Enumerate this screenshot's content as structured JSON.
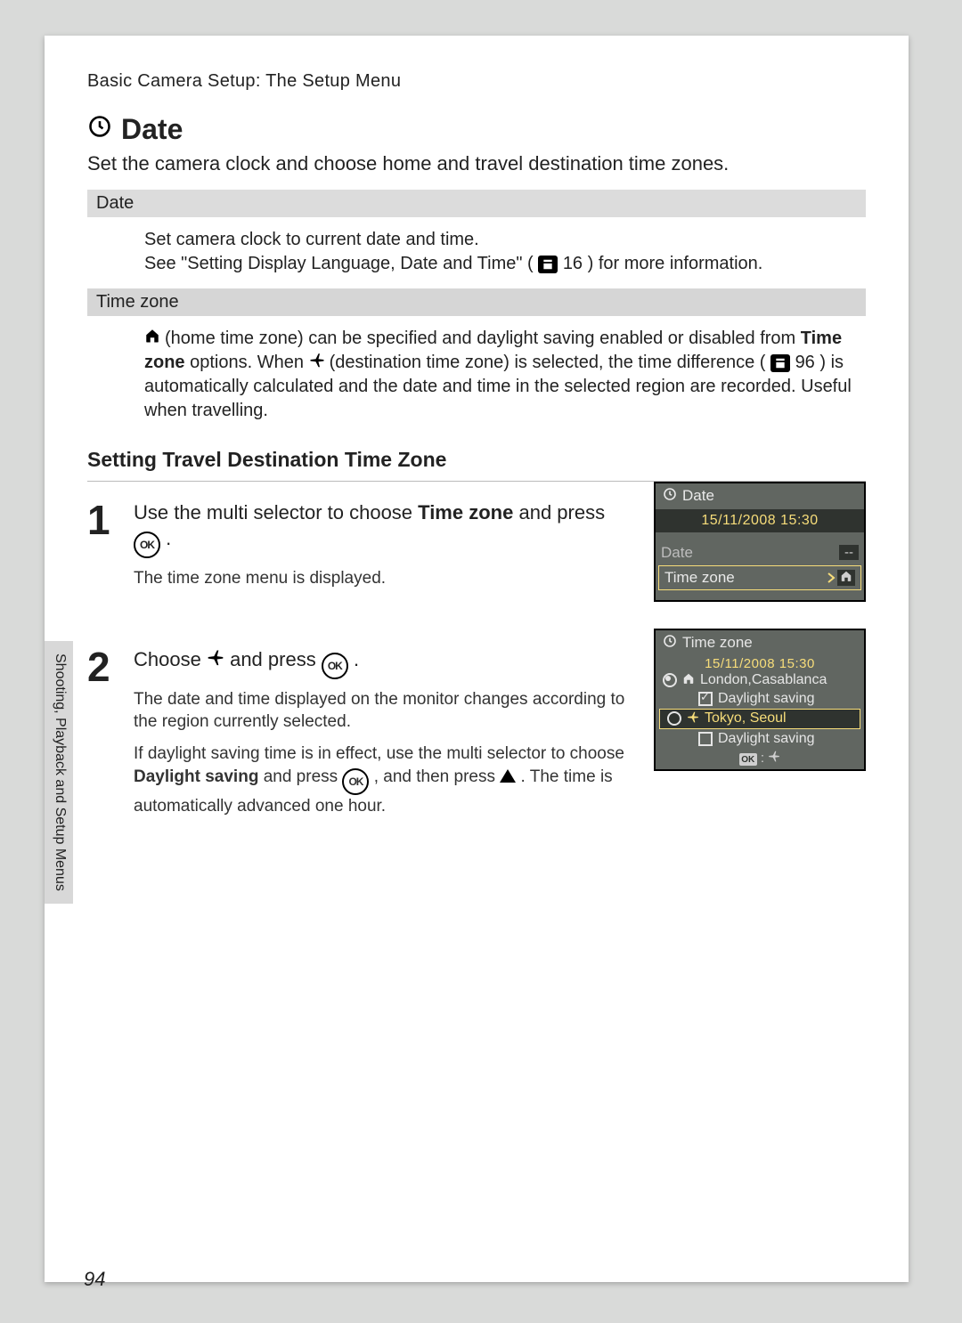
{
  "header": "Basic Camera Setup: The Setup Menu",
  "title": "Date",
  "intro": "Set the camera clock and choose home and travel destination time zones.",
  "sections": {
    "date": {
      "label": "Date",
      "body1": "Set camera clock to current date and time.",
      "body2a": "See \"Setting Display Language, Date and Time\" (",
      "body2_ref": "16",
      "body2b": ") for more information."
    },
    "tz": {
      "label": "Time zone",
      "b1a": " (home time zone) can be specified and daylight saving enabled or disabled from ",
      "bold": "Time zone",
      "b1b": " options. When ",
      "b1c": " (destination time zone) is selected, the time difference (",
      "ref": "96",
      "b1d": ") is automatically calculated and the date and time in the selected region are recorded. Useful when travelling."
    }
  },
  "subhead": "Setting Travel Destination Time Zone",
  "steps": {
    "s1": {
      "num": "1",
      "lead_a": "Use the multi selector to choose ",
      "lead_bold": "Time zone",
      "lead_b": " and press ",
      "lead_c": ".",
      "note": "The time zone menu is displayed."
    },
    "s2": {
      "num": "2",
      "lead_a": "Choose ",
      "lead_b": " and press ",
      "lead_c": ".",
      "note1": "The date and time displayed on the monitor changes according to the region currently selected.",
      "note2a": "If daylight saving time is in effect, use the multi selector to choose ",
      "note2_bold": "Daylight saving",
      "note2b": " and press ",
      "note2c": ", and then press ",
      "note2d": ". The time is automatically advanced one hour."
    }
  },
  "lcd1": {
    "title": "Date",
    "datetime": "15/11/2008  15:30",
    "row_date": "Date",
    "row_date_val": "--",
    "row_tz": "Time zone"
  },
  "lcd2": {
    "title": "Time zone",
    "datetime": "15/11/2008    15:30",
    "home": "London,Casablanca",
    "home_ds": "Daylight saving",
    "dest": "Tokyo, Seoul",
    "dest_ds": "Daylight saving",
    "foot_sep": ":"
  },
  "sidebar": "Shooting, Playback and Setup Menus",
  "pagenum": "94",
  "ok_label": "OK"
}
